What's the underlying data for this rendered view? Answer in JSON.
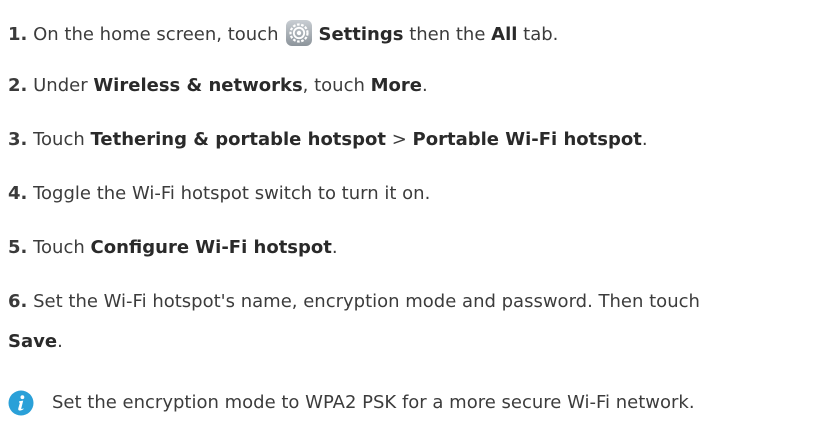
{
  "steps": [
    {
      "num": "1.",
      "t1": "On the home screen, touch",
      "b1": "Settings",
      "t2": "then the",
      "b2": "All",
      "t3": "tab."
    },
    {
      "num": "2.",
      "t1": "Under",
      "b1": "Wireless & networks",
      "t2": ", touch",
      "b2": "More",
      "t3": "."
    },
    {
      "num": "3.",
      "t1": "Touch",
      "b1": "Tethering & portable hotspot",
      "t2": ">",
      "b2": "Portable Wi-Fi hotspot",
      "t3": "."
    },
    {
      "num": "4.",
      "t1": "Toggle the Wi-Fi hotspot switch to turn it on."
    },
    {
      "num": "5.",
      "t1": "Touch",
      "b1": "Configure Wi-Fi hotspot",
      "t2": "."
    },
    {
      "num": "6.",
      "t1": "Set the Wi-Fi hotspot's name, encryption mode and password. Then touch",
      "b1": "Save",
      "t2": "."
    }
  ],
  "tip": {
    "icon": "info-icon",
    "text": "Set the encryption mode to WPA2 PSK for a more secure Wi-Fi network."
  },
  "icons": {
    "settings": "settings-gear-icon"
  },
  "colors": {
    "text": "#3c3c3c",
    "info_icon": "#2aa0d8"
  }
}
